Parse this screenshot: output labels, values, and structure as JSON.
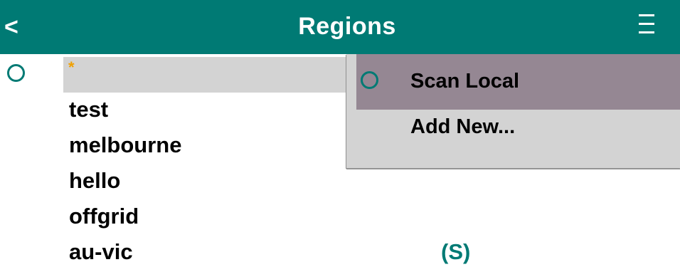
{
  "header": {
    "back_label": "<",
    "title": "Regions",
    "menu_icon": "hamburger-menu-icon",
    "accent_color": "#007a74"
  },
  "regions": {
    "selected_marker": "*",
    "items": [
      {
        "name": "test"
      },
      {
        "name": "melbourne"
      },
      {
        "name": "hello"
      },
      {
        "name": "offgrid"
      },
      {
        "name": "au-vic",
        "flag": "(S)"
      }
    ]
  },
  "menu": {
    "items": [
      {
        "label": "Scan Local",
        "highlighted": true,
        "icon": "radio-circle-icon"
      },
      {
        "label": "Add New...",
        "highlighted": false
      }
    ],
    "highlight_color": "#958793",
    "background_color": "#d3d3d3"
  }
}
